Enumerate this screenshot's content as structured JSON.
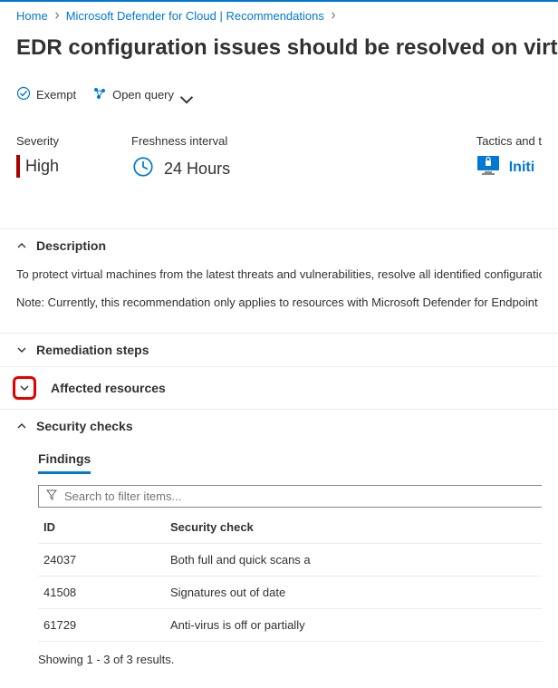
{
  "breadcrumbs": {
    "home": "Home",
    "parent": "Microsoft Defender for Cloud | Recommendations",
    "current": ""
  },
  "title": "EDR configuration issues should be resolved on virtual m",
  "actions": {
    "exempt": "Exempt",
    "open_query": "Open query"
  },
  "info": {
    "severity_label": "Severity",
    "severity_value": "High",
    "freshness_label": "Freshness interval",
    "freshness_value": "24 Hours",
    "tactics_label": "Tactics and t",
    "tactics_value": "Initi"
  },
  "sections": {
    "description": {
      "title": "Description",
      "p1": "To protect virtual machines from the latest threats and vulnerabilities, resolve all identified configuration issue",
      "p2": "Note: Currently, this recommendation only applies to resources with Microsoft Defender for Endpoint (MDE) e"
    },
    "remediation": {
      "title": "Remediation steps"
    },
    "affected": {
      "title": "Affected resources"
    },
    "security": {
      "title": "Security checks",
      "findings_label": "Findings",
      "search_placeholder": "Search to filter items...",
      "col_id": "ID",
      "col_check": "Security check",
      "rows": [
        {
          "id": "24037",
          "check": "Both full and quick scans a"
        },
        {
          "id": "41508",
          "check": "Signatures out of date"
        },
        {
          "id": "61729",
          "check": "Anti-virus is off or partially"
        }
      ],
      "results_summary": "Showing 1 - 3 of 3 results."
    }
  }
}
